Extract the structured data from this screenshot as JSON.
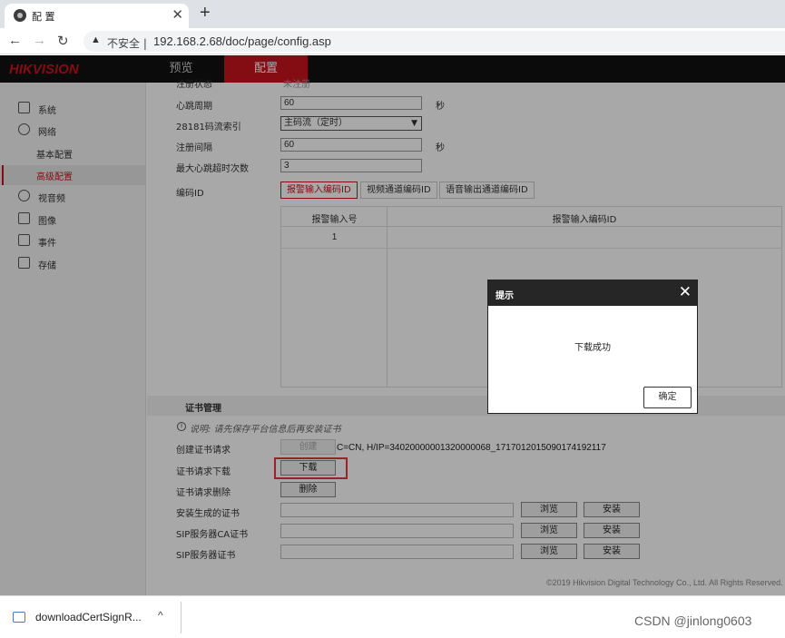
{
  "browser": {
    "tab_title": "配 置",
    "tab_close": "✕",
    "new_tab": "+",
    "back": "←",
    "forward": "→",
    "reload": "↻",
    "security_icon": "warning-triangle-icon",
    "security_text": "不安全 |",
    "url": "192.168.2.68/doc/page/config.asp"
  },
  "app": {
    "logo": "HIKVISION",
    "nav": [
      {
        "label": "预览"
      },
      {
        "label": "配置"
      }
    ],
    "accent_color": "#c8141e"
  },
  "sidebar": {
    "items": [
      {
        "label": "系统",
        "icon": "monitor-icon"
      },
      {
        "label": "网络",
        "icon": "globe-icon"
      },
      {
        "label": "基本配置"
      },
      {
        "label": "高级配置"
      },
      {
        "label": "视音频",
        "icon": "camera-mic-icon"
      },
      {
        "label": "图像",
        "icon": "image-icon"
      },
      {
        "label": "事件",
        "icon": "calendar-icon"
      },
      {
        "label": "存储",
        "icon": "storage-icon"
      }
    ]
  },
  "form": {
    "status_label": "注册状态",
    "status_value": "未注册",
    "heartbeat_label": "心跳周期",
    "heartbeat_value": "60",
    "heartbeat_unit": "秒",
    "stream_label": "28181码流索引",
    "stream_value": "主码流（定时）",
    "register_interval_label": "注册间隔",
    "register_interval_value": "60",
    "register_interval_unit": "秒",
    "max_timeout_label": "最大心跳超时次数",
    "max_timeout_value": "3",
    "code_id_label": "编码ID",
    "subtabs": [
      "报警输入编码ID",
      "视频通道编码ID",
      "语音输出通道编码ID"
    ],
    "table": {
      "headers": [
        "报警输入号",
        "报警输入编码ID"
      ],
      "rows": [
        [
          "1",
          ""
        ]
      ]
    }
  },
  "cert": {
    "section_title": "证书管理",
    "note": "说明: 请先保存平台信息后再安装证书",
    "create_label": "创建证书请求",
    "create_button": "创建",
    "create_value": "C=CN, H/IP=34020000001320000068_1717012015090174192117",
    "download_label": "证书请求下载",
    "download_button": "下载",
    "delete_label": "证书请求删除",
    "delete_button": "删除",
    "install_rows": [
      {
        "label": "安装生成的证书",
        "browse": "浏览",
        "install": "安装"
      },
      {
        "label": "SIP服务器CA证书",
        "browse": "浏览",
        "install": "安装"
      },
      {
        "label": "SIP服务器证书",
        "browse": "浏览",
        "install": "安装"
      }
    ]
  },
  "footer": "©2019 Hikvision Digital Technology Co., Ltd. All Rights Reserved.",
  "dialog": {
    "title": "提示",
    "close": "✕",
    "message": "下载成功",
    "ok": "确定"
  },
  "download_bar": {
    "filename": "downloadCertSignR...",
    "caret": "^",
    "watermark": "CSDN @jinlong0603"
  }
}
